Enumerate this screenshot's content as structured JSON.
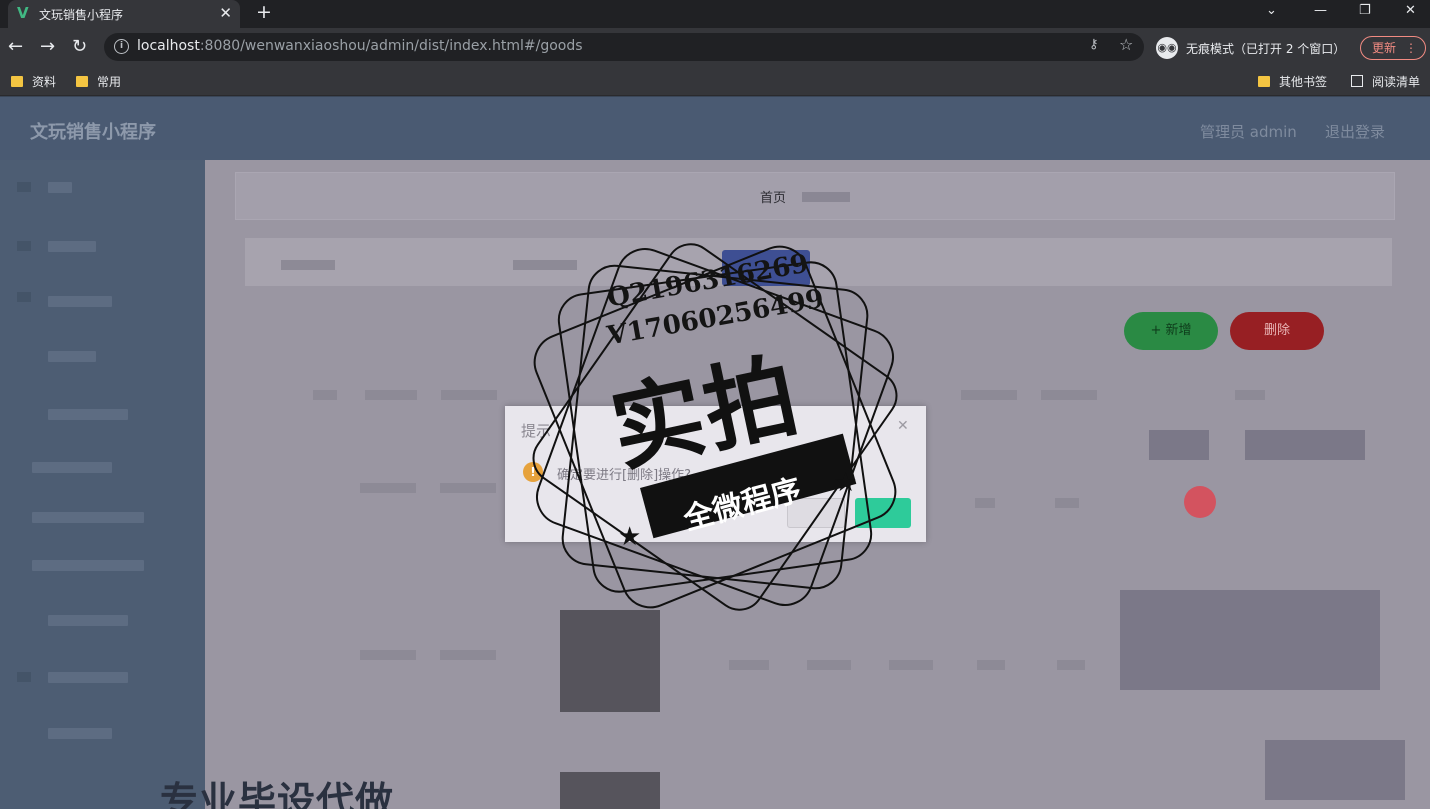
{
  "browser": {
    "tab_title": "文玩销售小程序",
    "tab_close": "✕",
    "new_tab": "+",
    "window_controls": [
      "⌄",
      "—",
      "❐",
      "✕"
    ],
    "nav": {
      "back": "←",
      "forward": "→",
      "reload": "↻"
    },
    "url_host": "localhost",
    "url_rest": ":8080/wenwanxiaoshou/admin/dist/index.html#/goods",
    "incognito_label": "无痕模式（已打开 2 个窗口）",
    "update_label": "更新",
    "bookmarks_left": [
      "资料",
      "常用"
    ],
    "bookmarks_right": [
      "其他书签",
      "阅读清单"
    ]
  },
  "app": {
    "title": "文玩销售小程序",
    "admin_label": "管理员 admin",
    "logout_label": "退出登录",
    "breadcrumb_home": "首页",
    "add_button_label": "+ 新增",
    "delete_button_label": "删除"
  },
  "dialog": {
    "title": "提示",
    "close": "✕",
    "message": "确定要进行[删除]操作?"
  },
  "watermark": {
    "qq": "Q2196316269",
    "wechat": "V17060256499",
    "main": "实拍",
    "sub": "全微程序",
    "bottom": "专业毕设代做"
  }
}
